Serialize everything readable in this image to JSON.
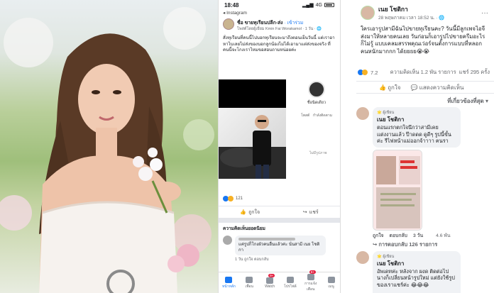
{
  "phone": {
    "status": {
      "time": "18:48",
      "network": "4G"
    },
    "back_label": "◂ Instagram",
    "post": {
      "group": "ชื่อ ขายทุเรียนปลีก-ส่ง",
      "join": "· เข้าร่วม",
      "sub": "โพสต์โดยผู้เยี่ยม Kmin Fai Worakamol · 1 วัน · 🌐",
      "text": "สั่งทุเรียนที่คนนี้ไปบอกทุเรียนจะมาถึงตอนเย็นวันนี้ แต่เราอาหาไบเลยไม่ส่งของบอกลูกน้องไม่ได้เอามาแต่ส่งของจริง ที่คนนี้จะโกงเราไหมขอสอบถามหน่อยค่ะ"
    },
    "shared_card": {
      "profile_name": "ชื่อนิดเดียว",
      "stat_labels": [
        "โพสต์",
        "ผู้ติดตาม",
        "กำลังติดตาม"
      ],
      "footer": "ไม่มีรูปภาพ"
    },
    "actions": {
      "like": "ถูกใจ",
      "share": "แชร์"
    },
    "reaction_count": "121",
    "top_comments_label": "ความคิดเห็นยอดนิยม",
    "comment": {
      "text": "แค่รูปก็โกงผัวคนอื่นแล้วค่ะ นั่นสามี เนย โชติกา",
      "meta": "1 วัน   ถูกใจ   ตอบกลับ"
    },
    "tabs": [
      {
        "label": "หน้าหลัก",
        "icon": "home-icon",
        "badge": ""
      },
      {
        "label": "เพื่อน",
        "icon": "friends-icon",
        "badge": ""
      },
      {
        "label": "Watch",
        "icon": "watch-icon",
        "badge": "9+"
      },
      {
        "label": "โปรไฟล์",
        "icon": "profile-icon",
        "badge": ""
      },
      {
        "label": "การแจ้งเตือน",
        "icon": "bell-icon",
        "badge": "9+"
      },
      {
        "label": "เมนู",
        "icon": "menu-icon",
        "badge": ""
      }
    ]
  },
  "fb": {
    "author": "เนย โชติกา",
    "date": "28 พฤษภาคม เวลา 18:52 น. · 🌐",
    "post_text": "ใครเอารูปสามีฉันไปขายทุเรียนคะ? วันนี้มีลูกเพจไอจีส่งมาให้หลายคนเลย วันก่อนก็เอารูปไปขายครีมอะไรก็ไม่รู้ แบบเคลมสรรพคุณเว่อร์จนตั้งการแบบที่หลอกคนหนักมากกก ได้ยยยย😭😭",
    "stats": {
      "reactions": "7.2",
      "comments": "ความคิดเห็น 1.2 พัน รายการ",
      "shares": "แชร์ 295 ครั้ง"
    },
    "actions": {
      "like": "ถูกใจ",
      "comment": "แสดงความคิดเห็น"
    },
    "relevant_label": "ที่เกี่ยวข้องที่สุด ▾",
    "comment1": {
      "badge": "🌟 ผู้เขียน",
      "name": "เนย โชติกา",
      "text": "ตอนแรกตกใจนึกว่าสามีเคยแต่งงานแล้ว ป๊าดดด ดูดีๆ รูปนี้ขั้นค่ะ รีไฟหน้าแม่ออกจ้าาาา ฅนรา",
      "meta": [
        "ถูกใจ",
        "ตอบกลับ",
        "3 วัน"
      ],
      "reacts": "4.6 พัน",
      "replies": "↪ การตอบกลับ 126 รายการ"
    },
    "comment2": {
      "badge": "🌟 ผู้เขียน",
      "name": "เนย โชติกา",
      "text": "อัพเดทค่ะ หลังจาก ผงด ติดต่อไป นางก็เปลี่ยนหน้ารูปใหม่ แต่ยังใช้รูปของเราแชร์ค่ะ 😂😂😂"
    }
  }
}
